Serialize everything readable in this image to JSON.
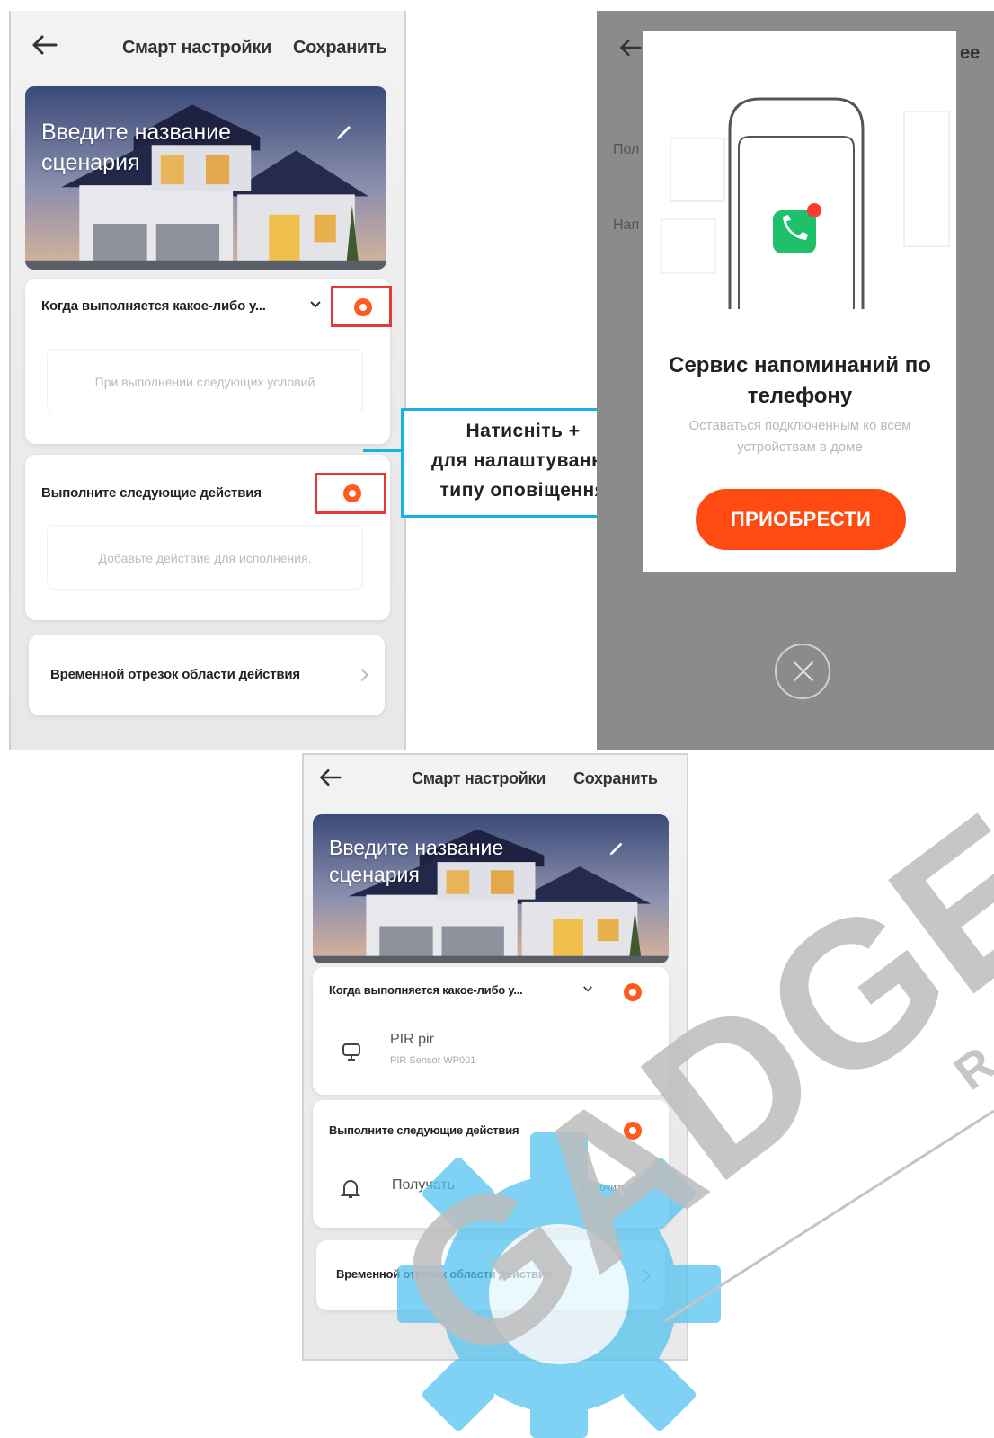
{
  "colors": {
    "accent": "#ff4a12",
    "callout_border": "#19b1e6",
    "highlight_box": "#e53935",
    "watermark": "#cfcfcf",
    "gear": "#55c3ef"
  },
  "screen1": {
    "title": "Смарт настройки",
    "save": "Сохранить",
    "banner_title": "Введите название\nсценария",
    "condition_title": "Когда выполняется какое-либо у...",
    "condition_placeholder": "При выполнении следующих условий",
    "action_title": "Выполните следующие действия",
    "action_placeholder": "Добавьте действие для исполнения.",
    "time_title": "Временной отрезок области действия"
  },
  "callout": {
    "line1": "Натисніть +",
    "line2": "для налаштування",
    "line3": "типу оповіщення"
  },
  "screen2": {
    "header_partial": "ee",
    "bg_label1": "Пол",
    "bg_label2": "Нап",
    "dialog_title": "Сервис напоминаний по телефону",
    "dialog_sub": "Оставаться подключенным ко всем устройствам в доме",
    "buy_button": "ПРИОБРЕСТИ"
  },
  "screen3": {
    "title": "Смарт настройки",
    "save": "Сохранить",
    "banner_title": "Введите название\nсценария",
    "condition_title": "Когда выполняется какое-либо у...",
    "device_name": "PIR pir",
    "device_sub": "PIR Sensor WP001",
    "action_title": "Выполните следующие действия",
    "action_name": "Получать",
    "action_state": "Включить",
    "time_title": "Временной отрезок области действия"
  },
  "watermark": {
    "text": "GADGE",
    "suffix": "R"
  }
}
